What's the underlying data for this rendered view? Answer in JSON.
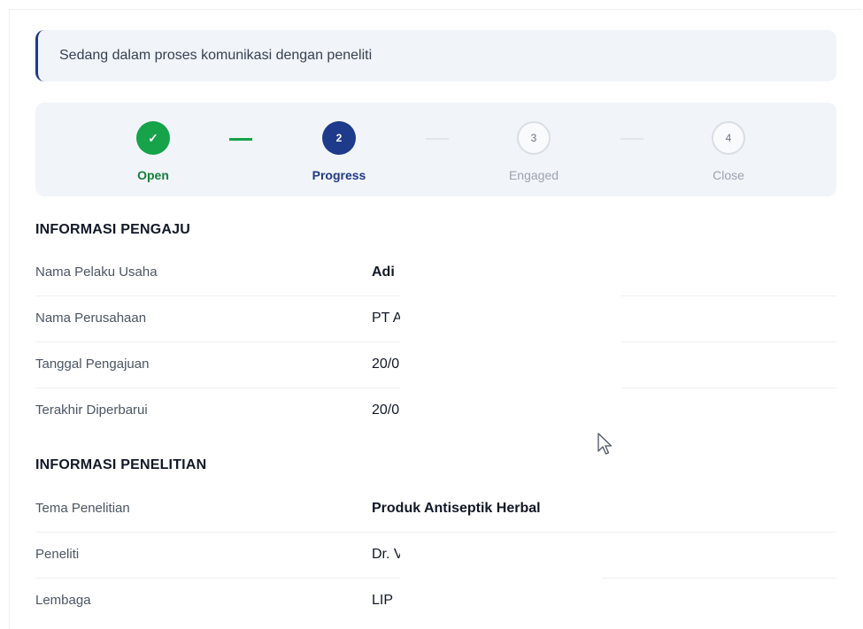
{
  "status_banner": {
    "text": "Sedang dalam proses komunikasi dengan peneliti"
  },
  "stepper": {
    "steps": [
      {
        "number": "✓",
        "label": "Open",
        "state": "done"
      },
      {
        "number": "2",
        "label": "Progress",
        "state": "active"
      },
      {
        "number": "3",
        "label": "Engaged",
        "state": "todo"
      },
      {
        "number": "4",
        "label": "Close",
        "state": "todo"
      }
    ],
    "colors": {
      "done": "#16a34a",
      "active": "#1e3a8a",
      "todo": "#d9dee6"
    }
  },
  "pengaju": {
    "title": "INFORMASI PENGAJU",
    "rows": [
      {
        "label": "Nama Pelaku Usaha",
        "value": "Adi"
      },
      {
        "label": "Nama Perusahaan",
        "value": "PT A"
      },
      {
        "label": "Tanggal Pengajuan",
        "value": "20/0"
      },
      {
        "label": "Terakhir Diperbarui",
        "value": "20/0"
      }
    ]
  },
  "penelitian": {
    "title": "INFORMASI PENELITIAN",
    "rows": [
      {
        "label": "Tema Penelitian",
        "value": "Produk Antiseptik Herbal"
      },
      {
        "label": "Peneliti",
        "value": "Dr. Vi"
      },
      {
        "label": "Lembaga",
        "value": "LIP"
      }
    ]
  }
}
